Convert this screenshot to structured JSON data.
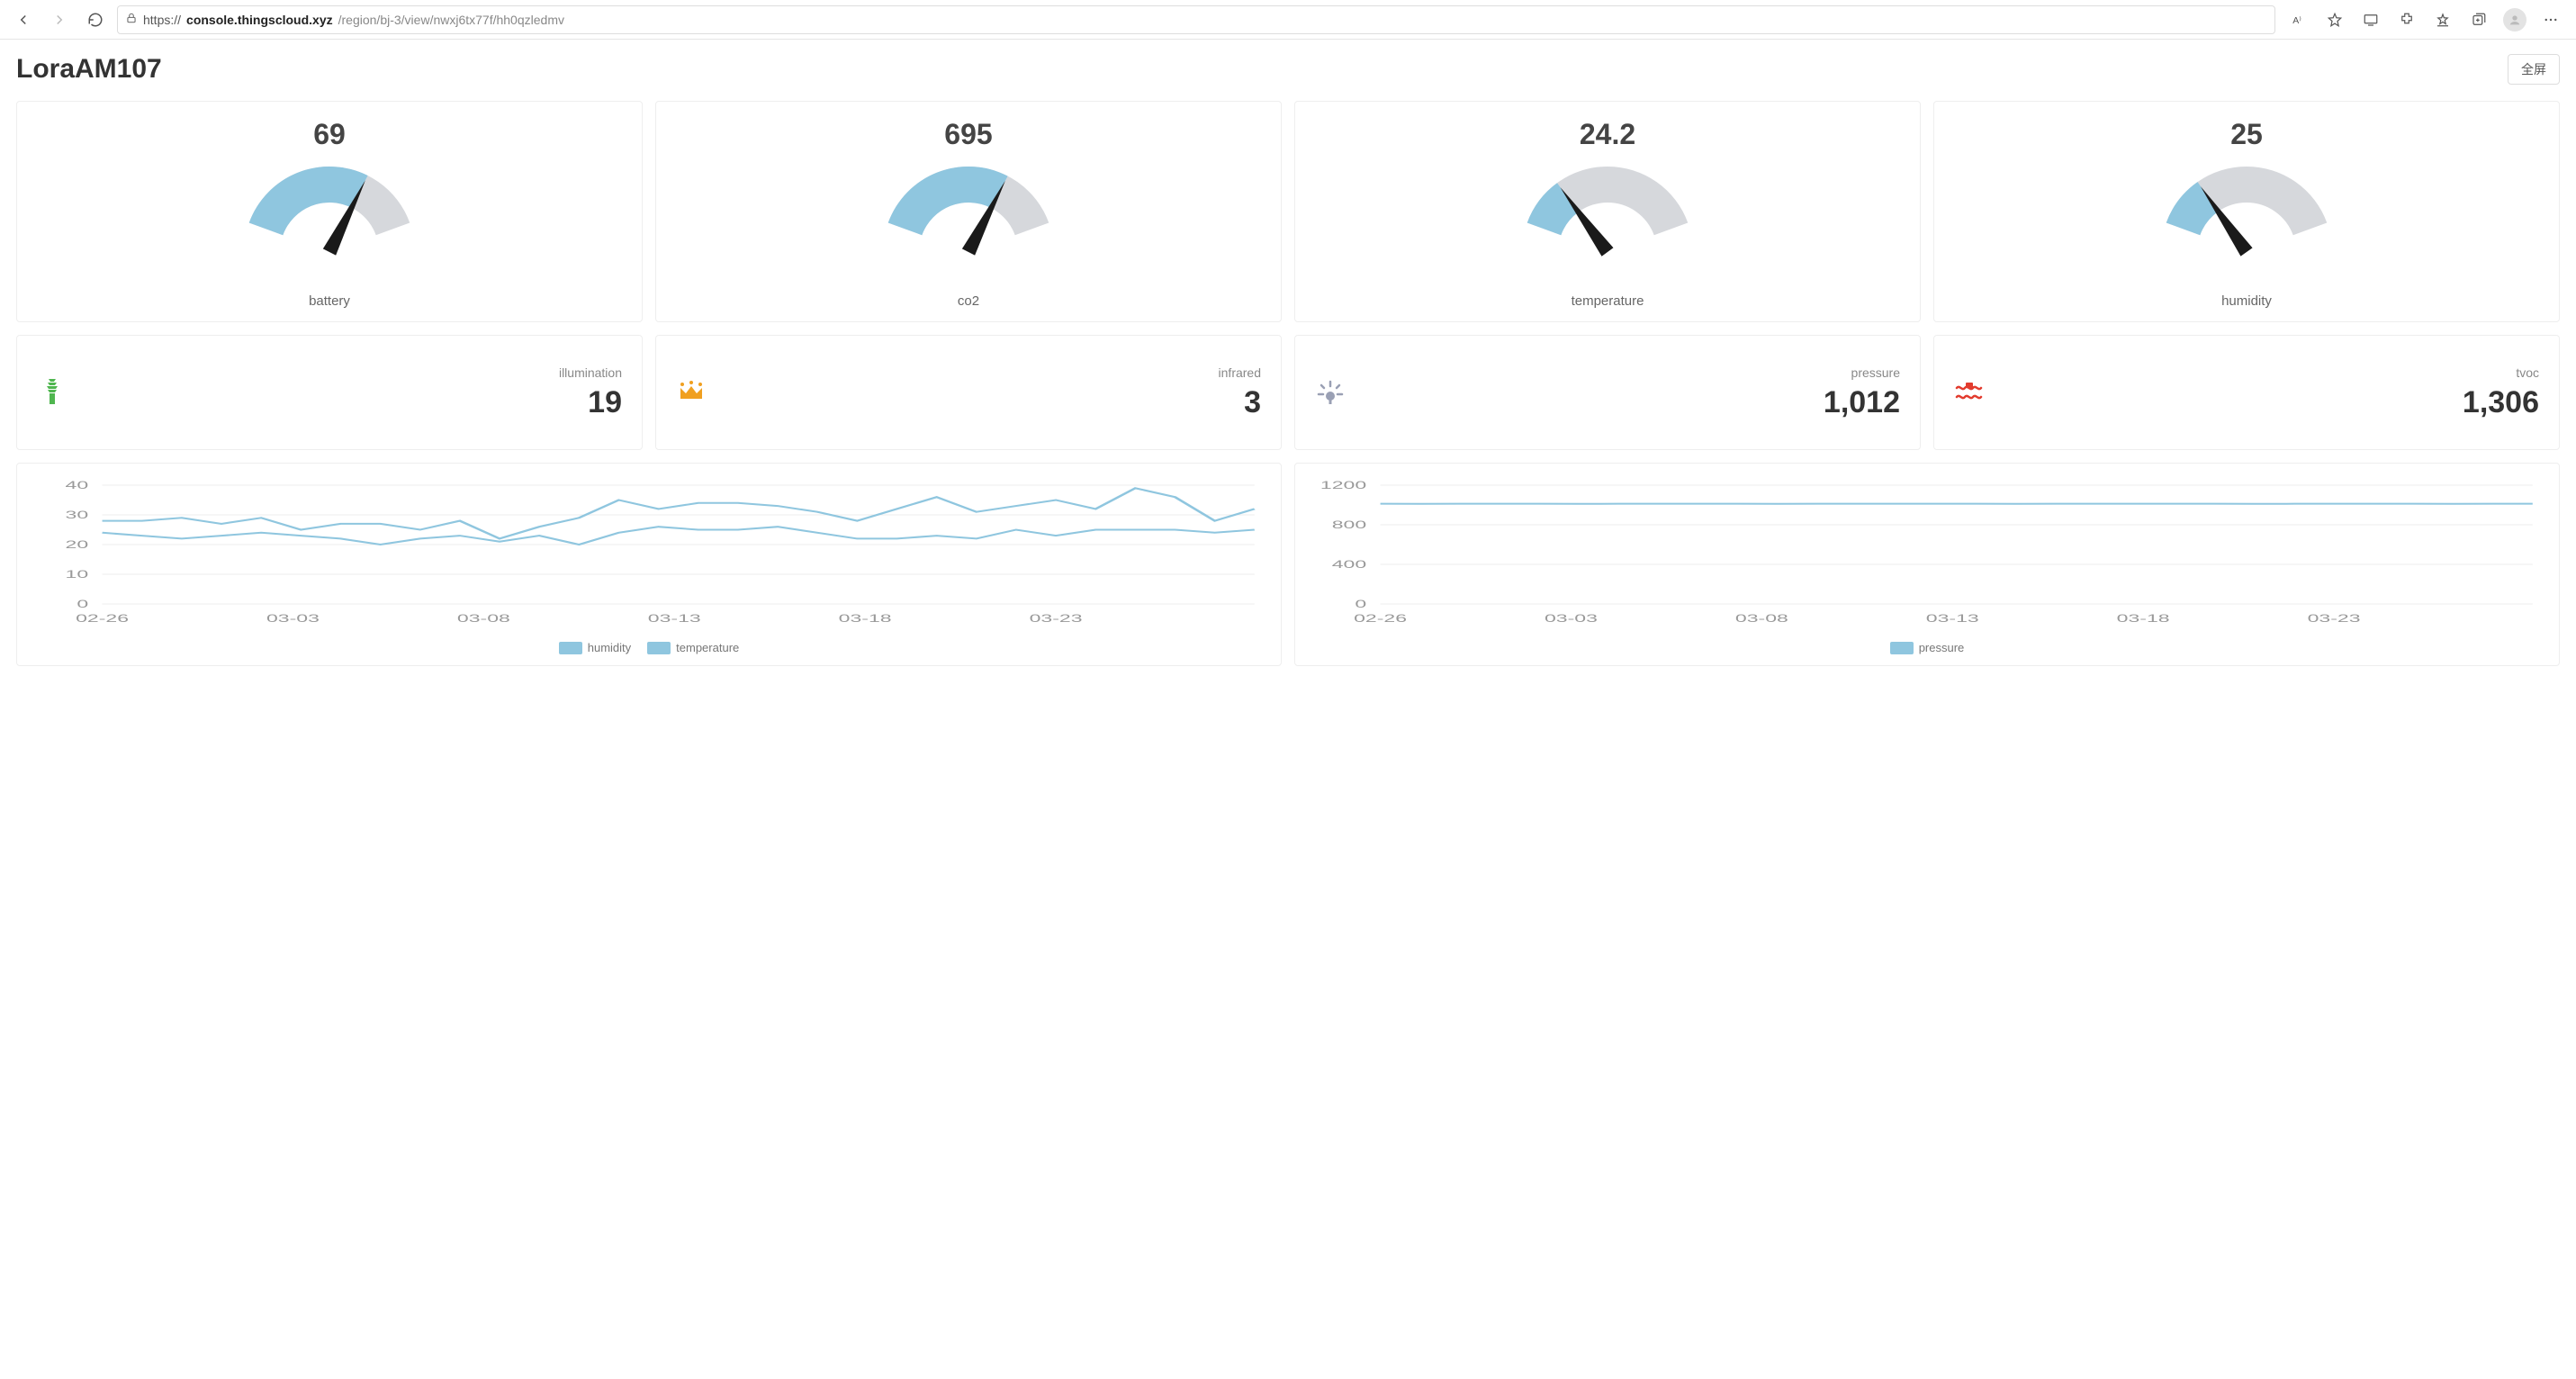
{
  "browser": {
    "url_prefix": "https://",
    "url_host": "console.thingscloud.xyz",
    "url_path": "/region/bj-3/view/nwxj6tx77f/hh0qzledmv"
  },
  "header": {
    "title": "LoraAM107",
    "fullscreen_label": "全屏"
  },
  "gauges": [
    {
      "label": "battery",
      "value": "69",
      "numeric": 69,
      "min": 0,
      "max": 100
    },
    {
      "label": "co2",
      "value": "695",
      "numeric": 695,
      "min": 0,
      "max": 1000
    },
    {
      "label": "temperature",
      "value": "24.2",
      "numeric": 24.2,
      "min": 0,
      "max": 100
    },
    {
      "label": "humidity",
      "value": "25",
      "numeric": 25,
      "min": 0,
      "max": 100
    }
  ],
  "stats": [
    {
      "name": "illumination",
      "value": "19",
      "icon": "bulb-spiral",
      "icon_color": "#4fb64f"
    },
    {
      "name": "infrared",
      "value": "3",
      "icon": "crown",
      "icon_color": "#f0a020"
    },
    {
      "name": "pressure",
      "value": "1,012",
      "icon": "light-rays",
      "icon_color": "#9aa0b4"
    },
    {
      "name": "tvoc",
      "value": "1,306",
      "icon": "wave-chip",
      "icon_color": "#e23b2e"
    }
  ],
  "colors": {
    "gauge_fill": "#8fc6df",
    "gauge_bg": "#d6d8dc",
    "needle": "#1a1a1a",
    "series": "#8fc6df"
  },
  "chart_data": [
    {
      "type": "line",
      "title": "",
      "xlabel": "",
      "ylabel": "",
      "ylim": [
        0,
        40
      ],
      "yticks": [
        0,
        10,
        20,
        30,
        40
      ],
      "x_tick_labels": [
        "02-26",
        "03-03",
        "03-08",
        "03-13",
        "03-18",
        "03-23"
      ],
      "x": [
        0,
        1,
        2,
        3,
        4,
        5,
        6,
        7,
        8,
        9,
        10,
        11,
        12,
        13,
        14,
        15,
        16,
        17,
        18,
        19,
        20,
        21,
        22,
        23,
        24,
        25,
        26,
        27,
        28,
        29
      ],
      "series": [
        {
          "name": "humidity",
          "values": [
            28,
            28,
            29,
            27,
            29,
            25,
            27,
            27,
            25,
            28,
            22,
            26,
            29,
            35,
            32,
            34,
            34,
            33,
            31,
            28,
            32,
            36,
            31,
            33,
            35,
            32,
            39,
            36,
            28,
            32
          ]
        },
        {
          "name": "temperature",
          "values": [
            24,
            23,
            22,
            23,
            24,
            23,
            22,
            20,
            22,
            23,
            21,
            23,
            20,
            24,
            26,
            25,
            25,
            26,
            24,
            22,
            22,
            23,
            22,
            25,
            23,
            25,
            25,
            25,
            24,
            25
          ]
        }
      ],
      "legend": [
        "humidity",
        "temperature"
      ]
    },
    {
      "type": "line",
      "title": "",
      "xlabel": "",
      "ylabel": "",
      "ylim": [
        0,
        1200
      ],
      "yticks": [
        0,
        400,
        800,
        1200
      ],
      "x_tick_labels": [
        "02-26",
        "03-03",
        "03-08",
        "03-13",
        "03-18",
        "03-23"
      ],
      "x": [
        0,
        1,
        2,
        3,
        4,
        5,
        6,
        7,
        8,
        9,
        10,
        11,
        12,
        13,
        14,
        15,
        16,
        17,
        18,
        19,
        20,
        21,
        22,
        23,
        24,
        25,
        26,
        27,
        28,
        29
      ],
      "series": [
        {
          "name": "pressure",
          "values": [
            1012,
            1011,
            1012,
            1013,
            1012,
            1011,
            1012,
            1012,
            1013,
            1012,
            1011,
            1012,
            1012,
            1013,
            1012,
            1012,
            1011,
            1012,
            1012,
            1013,
            1012,
            1012,
            1011,
            1012,
            1013,
            1012,
            1012,
            1011,
            1012,
            1012
          ]
        }
      ],
      "legend": [
        "pressure"
      ]
    }
  ]
}
